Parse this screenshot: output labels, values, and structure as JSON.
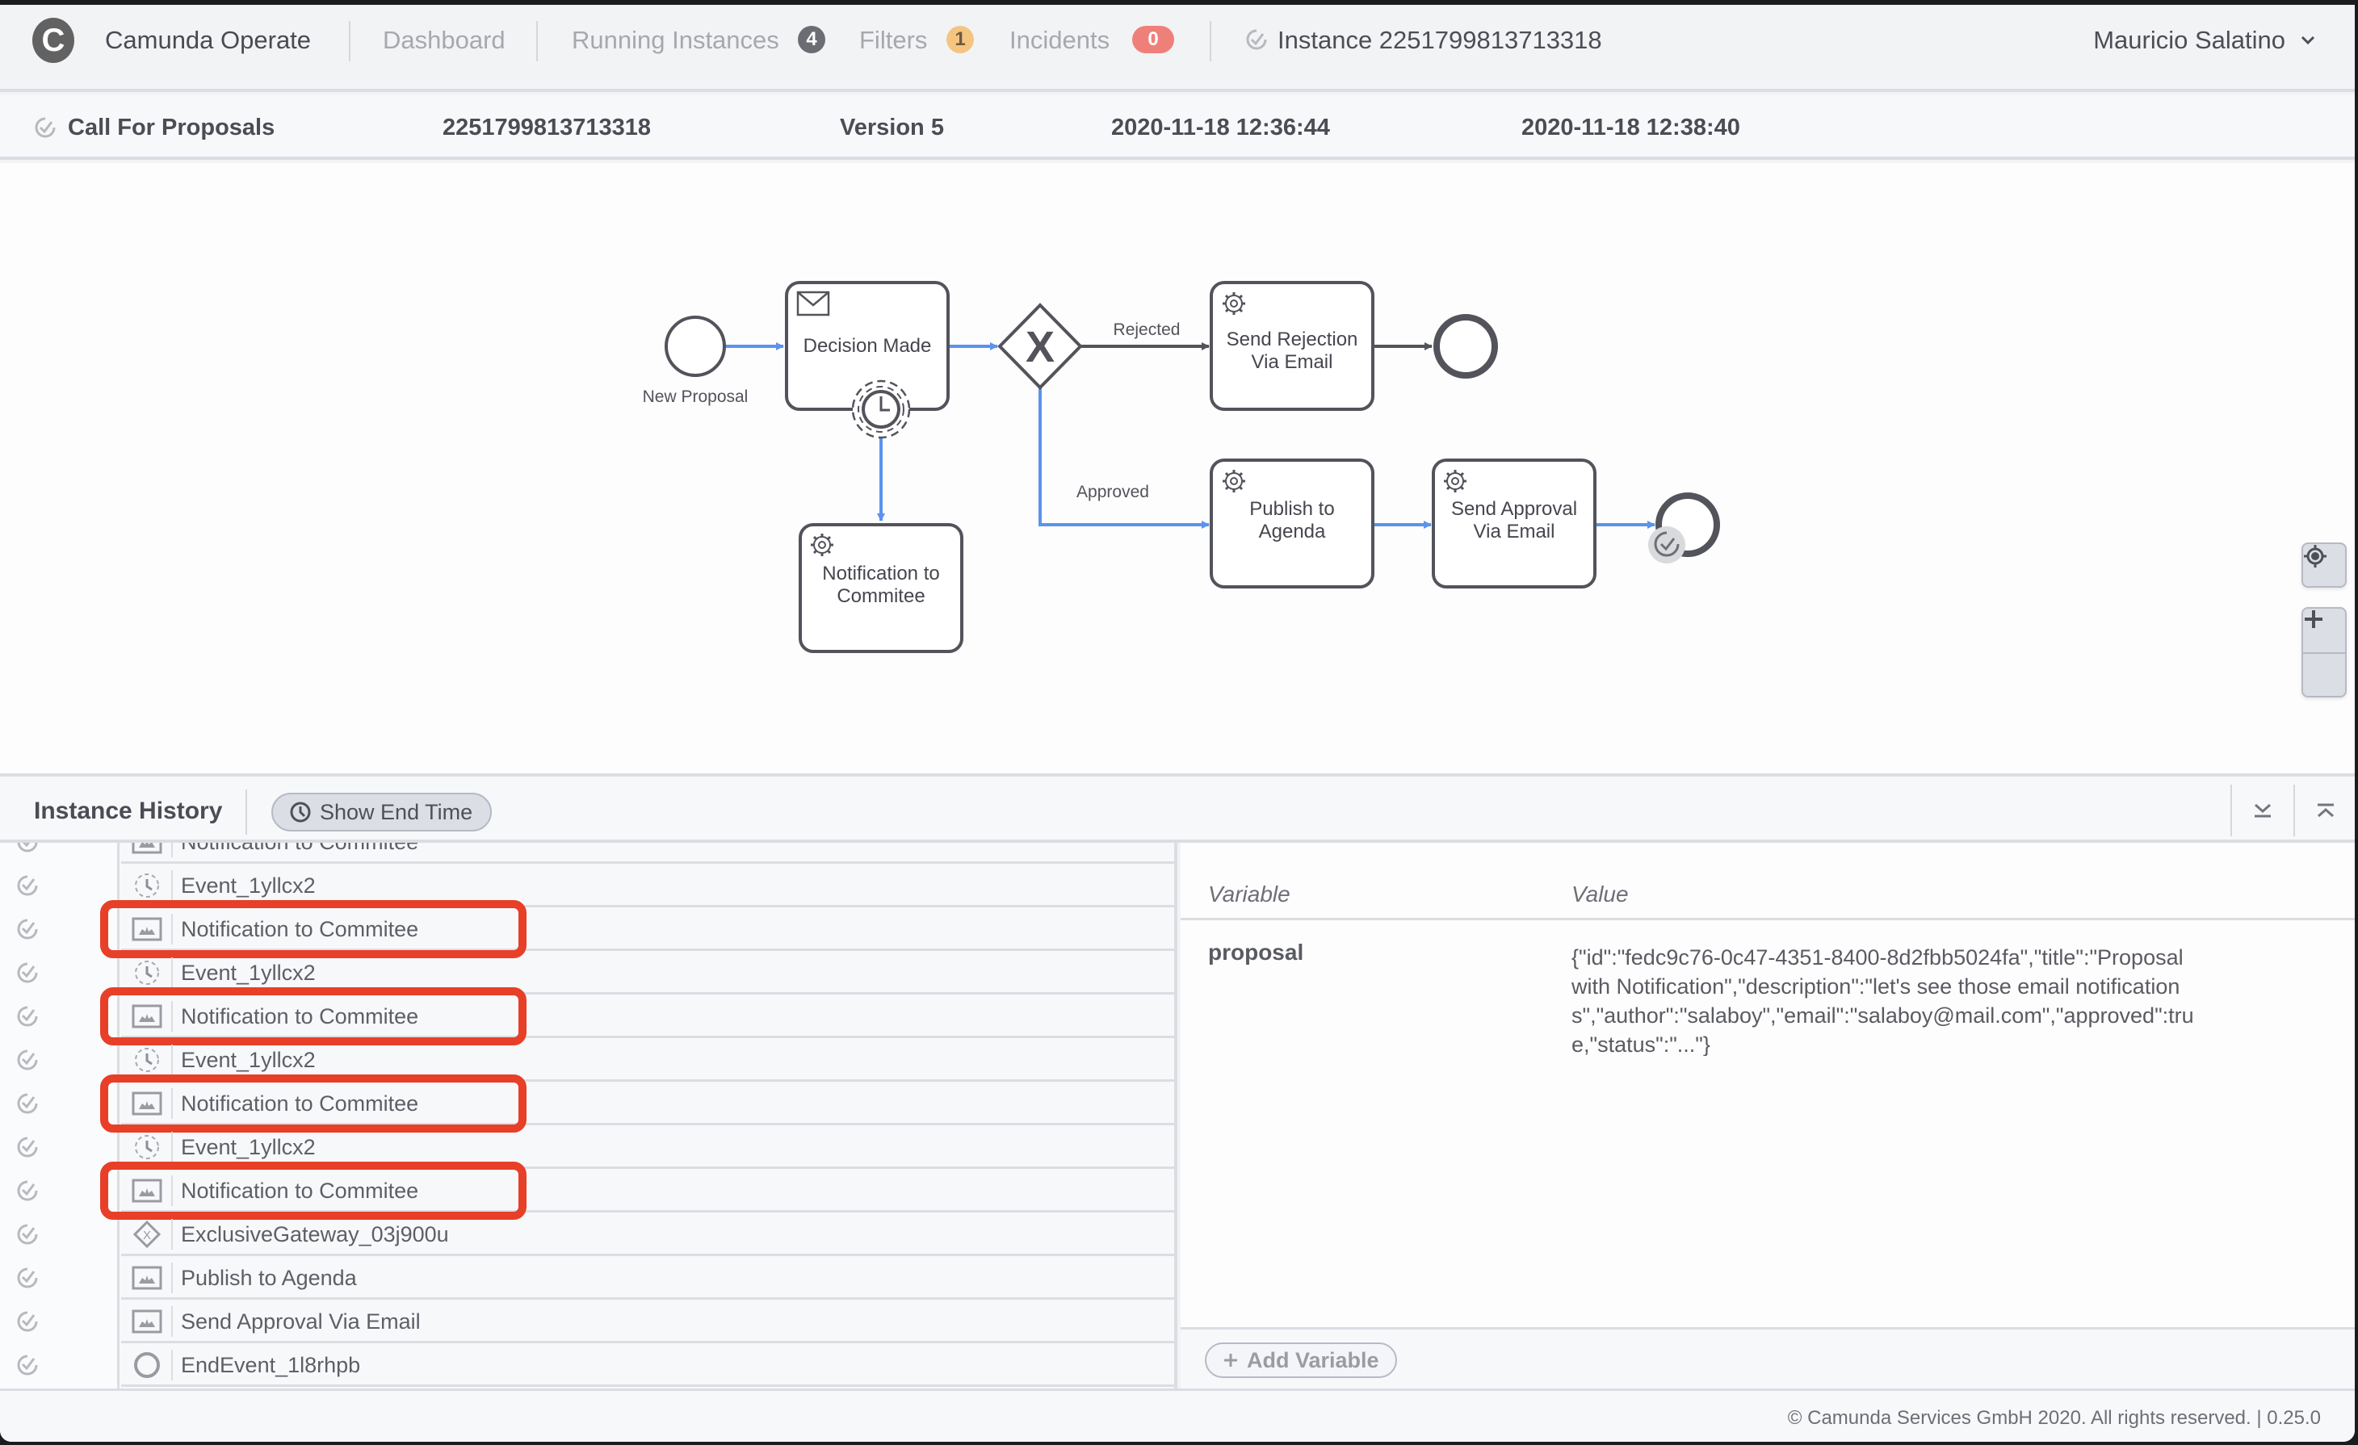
{
  "header": {
    "brand": "Camunda Operate",
    "logo_letter": "C",
    "nav": [
      {
        "label": "Dashboard"
      },
      {
        "label": "Running Instances",
        "badge": "4"
      },
      {
        "label": "Filters",
        "badge": "1"
      },
      {
        "label": "Incidents",
        "badge": "0"
      }
    ],
    "instance_title": "Instance 2251799813713318",
    "user": "Mauricio Salatino"
  },
  "summary": {
    "process_name": "Call For Proposals",
    "instance_id": "2251799813713318",
    "version": "Version 5",
    "start_date": "2020-11-18 12:36:44",
    "end_date": "2020-11-18 12:38:40"
  },
  "diagram": {
    "start_event_label": "New Proposal",
    "tasks": {
      "decision_made": "Decision Made",
      "send_rejection_1": "Send Rejection",
      "send_rejection_2": "Via Email",
      "notification_1": "Notification to",
      "notification_2": "Commitee",
      "publish_1": "Publish to",
      "publish_2": "Agenda",
      "send_approval_1": "Send Approval",
      "send_approval_2": "Via Email"
    },
    "flow_labels": {
      "rejected": "Rejected",
      "approved": "Approved"
    },
    "colors": {
      "taken_flow": "#5b93ee",
      "shape_stroke": "#52535b"
    }
  },
  "history": {
    "title": "Instance History",
    "show_end_time": "Show End Time",
    "rows": [
      {
        "label": "Notification to Commitee",
        "type": "task",
        "highlighted": false
      },
      {
        "label": "Event_1yllcx2",
        "type": "timer",
        "highlighted": false
      },
      {
        "label": "Notification to Commitee",
        "type": "task",
        "highlighted": true
      },
      {
        "label": "Event_1yllcx2",
        "type": "timer",
        "highlighted": false
      },
      {
        "label": "Notification to Commitee",
        "type": "task",
        "highlighted": true
      },
      {
        "label": "Event_1yllcx2",
        "type": "timer",
        "highlighted": false
      },
      {
        "label": "Notification to Commitee",
        "type": "task",
        "highlighted": true
      },
      {
        "label": "Event_1yllcx2",
        "type": "timer",
        "highlighted": false
      },
      {
        "label": "Notification to Commitee",
        "type": "task",
        "highlighted": true
      },
      {
        "label": "ExclusiveGateway_03j900u",
        "type": "gateway",
        "highlighted": false
      },
      {
        "label": "Publish to Agenda",
        "type": "task",
        "highlighted": false
      },
      {
        "label": "Send Approval Via Email",
        "type": "task",
        "highlighted": false
      },
      {
        "label": "EndEvent_1l8rhpb",
        "type": "end",
        "highlighted": false
      }
    ]
  },
  "variables": {
    "col_variable": "Variable",
    "col_value": "Value",
    "items": [
      {
        "name": "proposal",
        "value": "{\"id\":\"fedc9c76-0c47-4351-8400-8d2fbb5024fa\",\"title\":\"Proposal with Notification\",\"description\":\"let's see those email notifications\",\"author\":\"salaboy\",\"email\":\"salaboy@mail.com\",\"approved\":true,\"status\":\"...\"}"
      }
    ],
    "add_label": "Add Variable"
  },
  "footer": {
    "text": "© Camunda Services GmbH 2020. All rights reserved. | 0.25.0"
  },
  "highlight_color": "#e83f28"
}
